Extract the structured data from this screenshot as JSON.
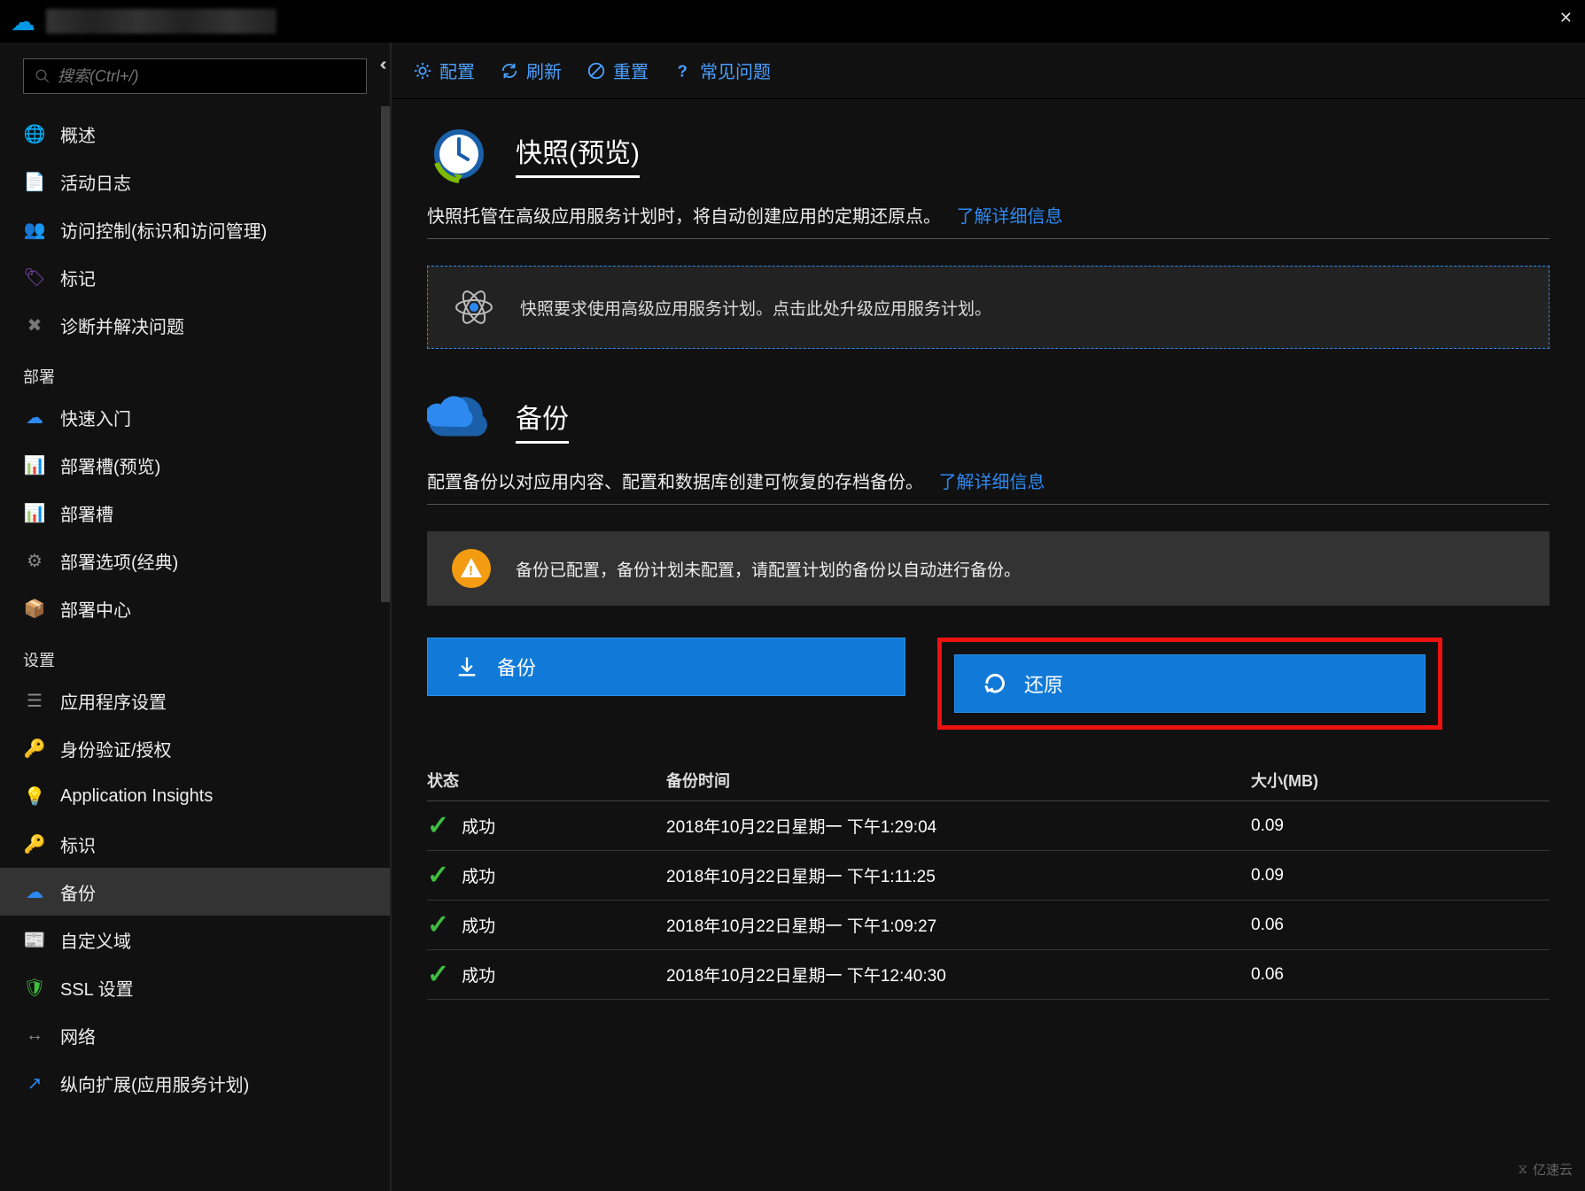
{
  "search": {
    "placeholder": "搜索(Ctrl+/)"
  },
  "toolbar": {
    "configure": "配置",
    "refresh": "刷新",
    "reset": "重置",
    "faq": "常见问题"
  },
  "sidebar": {
    "items_top": [
      {
        "icon": "globe",
        "label": "概述",
        "color": "#2d89ef"
      },
      {
        "icon": "log",
        "label": "活动日志",
        "color": "#2d89ef"
      },
      {
        "icon": "iam",
        "label": "访问控制(标识和访问管理)",
        "color": "#2d89ef"
      },
      {
        "icon": "tag",
        "label": "标记",
        "color": "#8a4fbf"
      },
      {
        "icon": "wrench",
        "label": "诊断并解决问题",
        "color": "#777"
      }
    ],
    "section_deploy": "部署",
    "items_deploy": [
      {
        "icon": "cloud",
        "label": "快速入门",
        "color": "#2d89ef"
      },
      {
        "icon": "slot",
        "label": "部署槽(预览)",
        "color": "#2d89ef"
      },
      {
        "icon": "slot",
        "label": "部署槽",
        "color": "#2d89ef"
      },
      {
        "icon": "gear",
        "label": "部署选项(经典)",
        "color": "#888"
      },
      {
        "icon": "center",
        "label": "部署中心",
        "color": "#2d89ef"
      }
    ],
    "section_settings": "设置",
    "items_settings": [
      {
        "icon": "settings",
        "label": "应用程序设置",
        "color": "#888"
      },
      {
        "icon": "key",
        "label": "身份验证/授权",
        "color": "#f0c040"
      },
      {
        "icon": "bulb",
        "label": "Application Insights",
        "color": "#666"
      },
      {
        "icon": "key",
        "label": "标识",
        "color": "#f0c040"
      },
      {
        "icon": "cloud",
        "label": "备份",
        "color": "#2d89ef",
        "active": true
      },
      {
        "icon": "page",
        "label": "自定义域",
        "color": "#2d89ef"
      },
      {
        "icon": "shield",
        "label": "SSL 设置",
        "color": "#3fbf3f"
      },
      {
        "icon": "net",
        "label": "网络",
        "color": "#888"
      },
      {
        "icon": "scale",
        "label": "纵向扩展(应用服务计划)",
        "color": "#2d89ef"
      }
    ]
  },
  "snapshot": {
    "title": "快照(预览)",
    "desc": "快照托管在高级应用服务计划时，将自动创建应用的定期还原点。",
    "link": "了解详细信息",
    "callout": "快照要求使用高级应用服务计划。点击此处升级应用服务计划。"
  },
  "backup": {
    "title": "备份",
    "desc": "配置备份以对应用内容、配置和数据库创建可恢复的存档备份。",
    "link": "了解详细信息",
    "warning": "备份已配置，备份计划未配置，请配置计划的备份以自动进行备份。",
    "btn_backup": "备份",
    "btn_restore": "还原",
    "col_status": "状态",
    "col_time": "备份时间",
    "col_size": "大小(MB)",
    "rows": [
      {
        "status": "成功",
        "time": "2018年10月22日星期一 下午1:29:04",
        "size": "0.09"
      },
      {
        "status": "成功",
        "time": "2018年10月22日星期一 下午1:11:25",
        "size": "0.09"
      },
      {
        "status": "成功",
        "time": "2018年10月22日星期一 下午1:09:27",
        "size": "0.06"
      },
      {
        "status": "成功",
        "time": "2018年10月22日星期一 下午12:40:30",
        "size": "0.06"
      }
    ]
  },
  "watermark": "亿速云",
  "icons": {
    "globe": "🌐",
    "log": "📄",
    "iam": "👥",
    "tag": "🏷",
    "wrench": "✖",
    "cloud": "☁",
    "slot": "📊",
    "gear": "⚙",
    "center": "📦",
    "settings": "☰",
    "key": "🔑",
    "bulb": "💡",
    "page": "📰",
    "shield": "🛡",
    "net": "↔",
    "scale": "↗"
  }
}
